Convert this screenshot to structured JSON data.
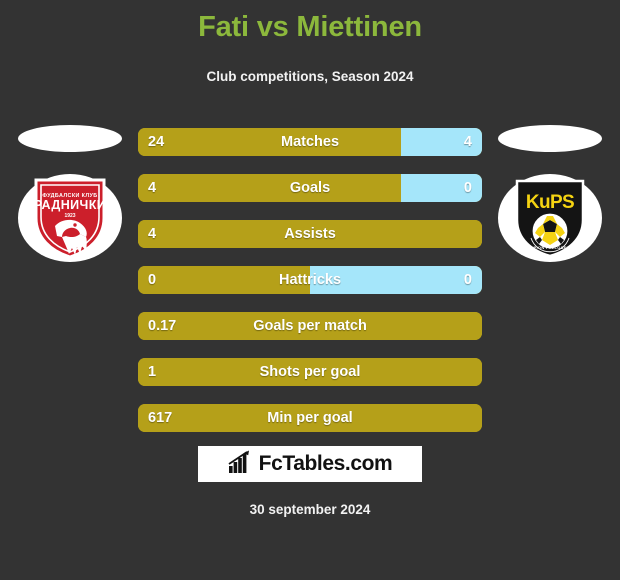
{
  "header": {
    "title": "Fati vs Miettinen",
    "subtitle": "Club competitions, Season 2024"
  },
  "teams": {
    "home": {
      "name": "Radnicki",
      "badge_icon": "radnicki-crest-icon",
      "crest_line1": "ФУДБАЛСКИ КЛУБ",
      "crest_line2": "РАДНИЧКИ",
      "crest_year": "1923",
      "colors": {
        "primary": "#cc1f2b",
        "dark": "#9e0f18",
        "text": "#ffffff"
      }
    },
    "away": {
      "name": "KuPS",
      "badge_icon": "kups-crest-icon",
      "crest_line1": "KuPS",
      "crest_line2": "KUOPION PALLOSEURA",
      "crest_year": "1923",
      "colors": {
        "primary": "#f5d312",
        "dark": "#1a1a1a",
        "text": "#f5d312"
      }
    }
  },
  "chart_data": {
    "type": "bar",
    "title": "Fati vs Miettinen",
    "subtitle": "Club competitions, Season 2024",
    "orientation": "horizontal-split",
    "categories": [
      "Matches",
      "Goals",
      "Assists",
      "Hattricks",
      "Goals per match",
      "Shots per goal",
      "Min per goal"
    ],
    "series": [
      {
        "name": "Fati",
        "values": [
          "24",
          "4",
          "4",
          "0",
          "0.17",
          "1",
          "617"
        ]
      },
      {
        "name": "Miettinen",
        "values": [
          "4",
          "0",
          "",
          "0",
          "",
          "",
          ""
        ]
      }
    ],
    "left_fill_percent": [
      76.5,
      76.5,
      100,
      50,
      100,
      100,
      100
    ],
    "legend": [
      "Fati",
      "Miettinen"
    ],
    "colors": {
      "left": "#b5a019",
      "right": "#a5e6fa",
      "background": "#333333"
    }
  },
  "rows": [
    {
      "label": "Matches",
      "home": "24",
      "away": "4",
      "left_pct": 76.5,
      "has_away": true
    },
    {
      "label": "Goals",
      "home": "4",
      "away": "0",
      "left_pct": 76.5,
      "has_away": true
    },
    {
      "label": "Assists",
      "home": "4",
      "away": "",
      "left_pct": 100,
      "has_away": false
    },
    {
      "label": "Hattricks",
      "home": "0",
      "away": "0",
      "left_pct": 50,
      "has_away": true
    },
    {
      "label": "Goals per match",
      "home": "0.17",
      "away": "",
      "left_pct": 100,
      "has_away": false
    },
    {
      "label": "Shots per goal",
      "home": "1",
      "away": "",
      "left_pct": 100,
      "has_away": false
    },
    {
      "label": "Min per goal",
      "home": "617",
      "away": "",
      "left_pct": 100,
      "has_away": false
    }
  ],
  "footer": {
    "logo_text": "FcTables.com",
    "logo_icon": "bar-chart-arrow-icon",
    "date": "30 september 2024"
  }
}
